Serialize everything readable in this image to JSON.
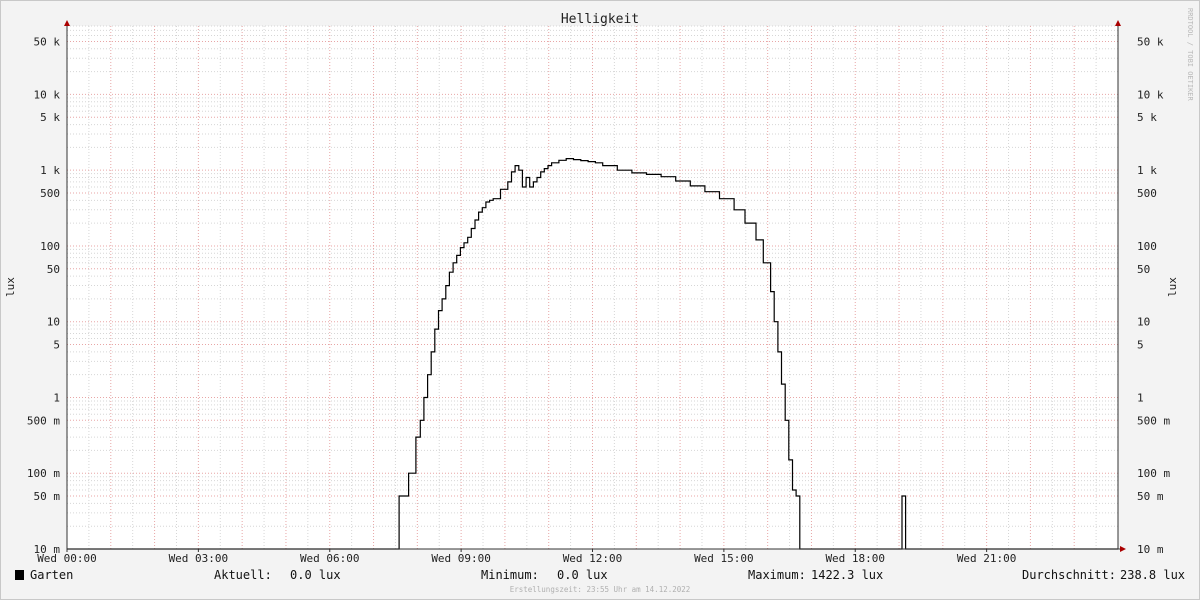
{
  "chart_data": {
    "type": "line",
    "title": "Helligkeit",
    "ylabel": "lux",
    "y_scale": "log",
    "ylim": [
      0.01,
      80000
    ],
    "y_ticks": [
      {
        "value": 50000,
        "label": "50 k"
      },
      {
        "value": 10000,
        "label": "10 k"
      },
      {
        "value": 5000,
        "label": "5 k"
      },
      {
        "value": 1000,
        "label": "1 k"
      },
      {
        "value": 500,
        "label": "500"
      },
      {
        "value": 100,
        "label": "100"
      },
      {
        "value": 50,
        "label": "50"
      },
      {
        "value": 10,
        "label": "10"
      },
      {
        "value": 5,
        "label": "5"
      },
      {
        "value": 1,
        "label": "1"
      },
      {
        "value": 0.5,
        "label": "500 m"
      },
      {
        "value": 0.1,
        "label": "100 m"
      },
      {
        "value": 0.05,
        "label": "50 m"
      },
      {
        "value": 0.01,
        "label": "10 m"
      }
    ],
    "xlim": [
      "00:00",
      "24:00"
    ],
    "x_ticks": [
      {
        "value": "00:00",
        "label": "Wed 00:00"
      },
      {
        "value": "03:00",
        "label": "Wed 03:00"
      },
      {
        "value": "06:00",
        "label": "Wed 06:00"
      },
      {
        "value": "09:00",
        "label": "Wed 09:00"
      },
      {
        "value": "12:00",
        "label": "Wed 12:00"
      },
      {
        "value": "15:00",
        "label": "Wed 15:00"
      },
      {
        "value": "18:00",
        "label": "Wed 18:00"
      },
      {
        "value": "21:00",
        "label": "Wed 21:00"
      }
    ],
    "grid": true,
    "series": [
      {
        "name": "Garten",
        "color": "#000000",
        "step": true,
        "x": [
          "00:00",
          "07:35",
          "07:48",
          "07:58",
          "08:04",
          "08:09",
          "08:14",
          "08:19",
          "08:24",
          "08:29",
          "08:34",
          "08:39",
          "08:44",
          "08:49",
          "08:54",
          "08:59",
          "09:04",
          "09:09",
          "09:14",
          "09:19",
          "09:24",
          "09:29",
          "09:34",
          "09:39",
          "09:44",
          "09:54",
          "10:04",
          "10:09",
          "10:14",
          "10:19",
          "10:24",
          "10:29",
          "10:34",
          "10:39",
          "10:44",
          "10:49",
          "10:54",
          "10:59",
          "11:04",
          "11:14",
          "11:24",
          "11:34",
          "11:44",
          "11:54",
          "12:04",
          "12:14",
          "12:34",
          "12:54",
          "13:14",
          "13:34",
          "13:54",
          "14:14",
          "14:34",
          "14:54",
          "15:14",
          "15:29",
          "15:44",
          "15:54",
          "16:04",
          "16:09",
          "16:14",
          "16:19",
          "16:24",
          "16:29",
          "16:34",
          "16:39",
          "16:44",
          "16:49",
          "16:54",
          "16:59",
          "17:04",
          "17:09",
          "17:14",
          "17:19",
          "17:24",
          "17:29",
          "17:34",
          "17:39",
          "17:44",
          "17:49",
          "18:04",
          "19:04",
          "19:09",
          "19:12",
          "24:00"
        ],
        "values": [
          0.01,
          0.05,
          0.1,
          0.3,
          0.5,
          1,
          2,
          4,
          8,
          14,
          20,
          30,
          45,
          60,
          75,
          95,
          110,
          130,
          170,
          220,
          280,
          320,
          380,
          400,
          420,
          560,
          700,
          950,
          1150,
          1000,
          600,
          800,
          600,
          700,
          800,
          950,
          1050,
          1150,
          1250,
          1350,
          1422.3,
          1380,
          1340,
          1300,
          1250,
          1150,
          1000,
          920,
          880,
          820,
          720,
          620,
          520,
          420,
          300,
          200,
          120,
          60,
          25,
          10,
          4,
          1.5,
          0.5,
          0.15,
          0.06,
          0.05,
          0.01,
          0.01,
          0.01,
          0.01,
          0.01,
          0.01,
          0.01,
          0.01,
          0.01,
          0.01,
          0.01,
          0.01,
          0.01,
          0.01,
          0.01,
          0.05,
          0.01,
          0.01,
          0.01
        ]
      }
    ]
  },
  "legend": {
    "series_name": "Garten",
    "series_color": "#000000",
    "current_label": "Aktuell:",
    "current_value": "0.0 lux",
    "min_label": "Minimum:",
    "min_value": "0.0 lux",
    "max_label": "Maximum:",
    "max_value": "1422.3 lux",
    "avg_label": "Durchschnitt:",
    "avg_value": "238.8 lux"
  },
  "watermark": "RRDTOOL / TOBI OETIKER",
  "footer": "Erstellungszeit: 23:55 Uhr am 14.12.2022"
}
